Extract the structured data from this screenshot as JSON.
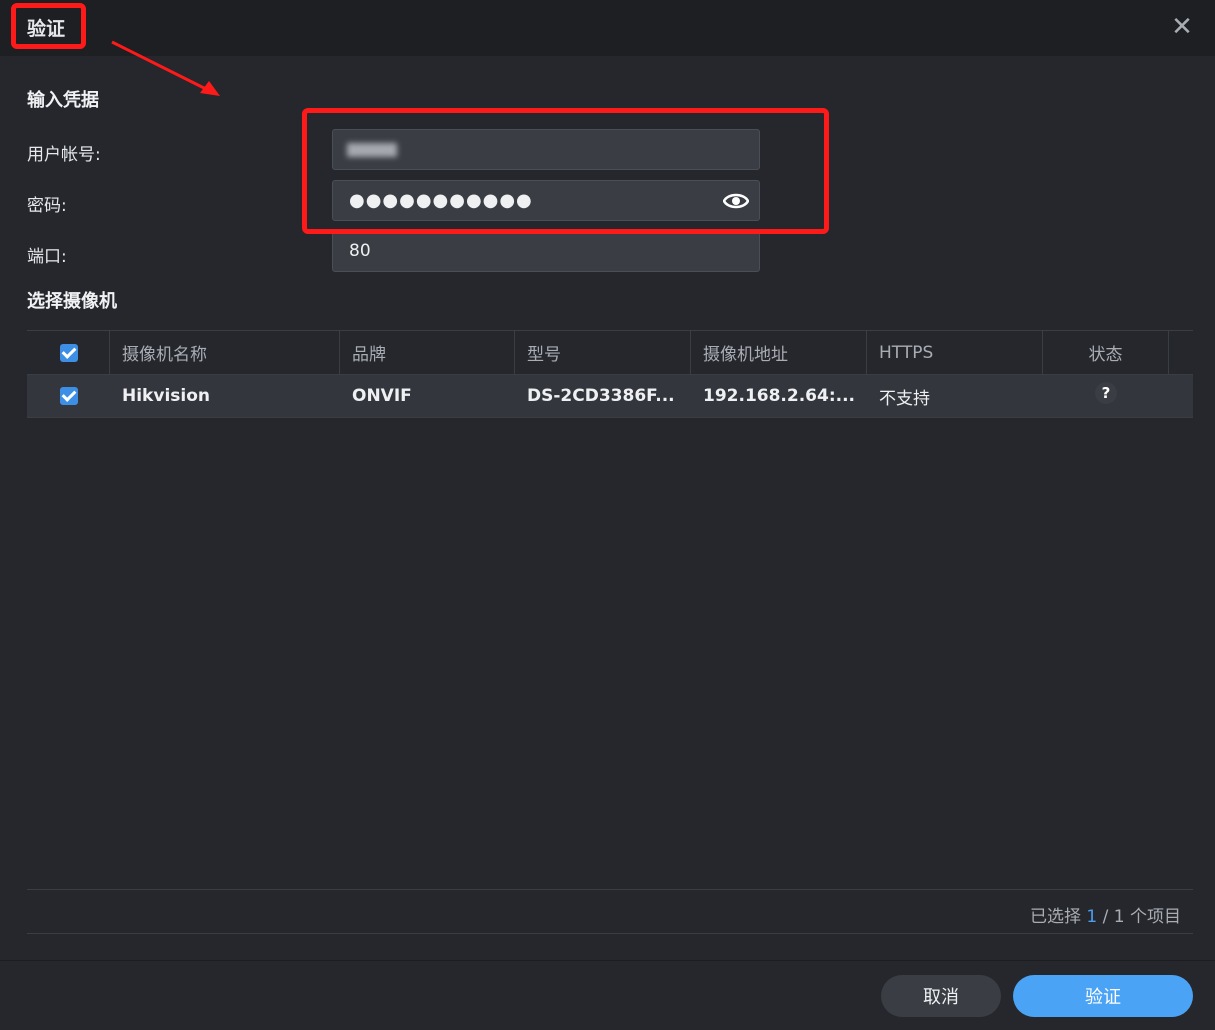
{
  "dialog": {
    "title": "验证",
    "close_label": "✕"
  },
  "credentials": {
    "section_title": "输入凭据",
    "username_label": "用户帐号:",
    "password_label": "密码:",
    "password_value": "●●●●●●●●●●●",
    "port_label": "端口:",
    "port_value": "80"
  },
  "cameras": {
    "section_title": "选择摄像机",
    "columns": [
      "摄像机名称",
      "品牌",
      "型号",
      "摄像机地址",
      "HTTPS",
      "状态"
    ],
    "rows": [
      {
        "checked": true,
        "name": "Hikvision",
        "brand": "ONVIF",
        "model": "DS-2CD3386F...",
        "address": "192.168.2.64:...",
        "https": "不支持",
        "status": "?"
      }
    ]
  },
  "selection": {
    "prefix": "已选择",
    "selected": "1",
    "separator": "/",
    "total": "1",
    "suffix": "个项目"
  },
  "buttons": {
    "cancel": "取消",
    "verify": "验证"
  },
  "colors": {
    "accent": "#4aa3f5",
    "annotation": "#ff1a1a"
  }
}
